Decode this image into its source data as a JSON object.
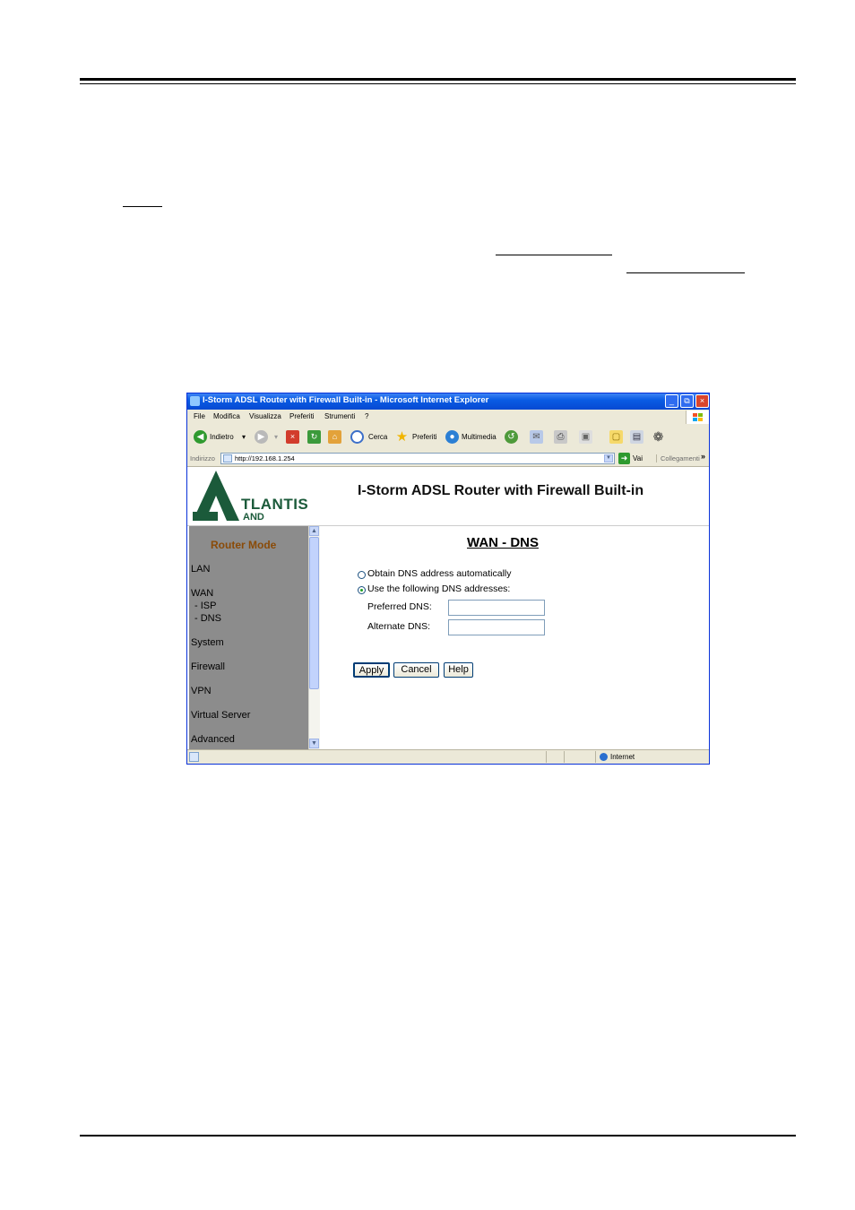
{
  "browser": {
    "title": "I-Storm ADSL Router with Firewall Built-in - Microsoft Internet Explorer",
    "window_controls": {
      "minimize": "_",
      "restore": "⧉",
      "close": "×"
    },
    "menu": [
      "File",
      "Modifica",
      "Visualizza",
      "Preferiti",
      "Strumenti",
      "?"
    ],
    "toolbar": {
      "back_label": "Indietro",
      "search_label": "Cerca",
      "favorites_label": "Preferiti",
      "media_label": "Multimedia"
    },
    "address": {
      "label": "Indirizzo",
      "url": "http://192.168.1.254",
      "go_label": "Vai",
      "links_label": "Collegamenti"
    },
    "status": {
      "zone": "Internet"
    }
  },
  "page": {
    "logo_text": "TLANTIS",
    "logo_sub": "AND",
    "heading": "I-Storm ADSL Router with Firewall Built-in",
    "sidebar": {
      "mode": "Router Mode",
      "items": [
        {
          "label": "LAN"
        },
        {
          "label": "WAN"
        },
        {
          "label": "- ISP"
        },
        {
          "label": "- DNS"
        },
        {
          "label": "System"
        },
        {
          "label": "Firewall"
        },
        {
          "label": "VPN"
        },
        {
          "label": "Virtual Server"
        },
        {
          "label": "Advanced"
        }
      ]
    },
    "section_title": "WAN - DNS",
    "options": {
      "auto": "Obtain DNS address automatically",
      "manual": "Use the following DNS addresses:",
      "selected": "manual"
    },
    "fields": {
      "preferred_label": "Preferred DNS:",
      "preferred_value": "",
      "alternate_label": "Alternate DNS:",
      "alternate_value": ""
    },
    "buttons": {
      "apply": "Apply",
      "cancel": "Cancel",
      "help": "Help"
    }
  },
  "colors": {
    "titlebar": "#0a5ce4",
    "sidebar_bg": "#8c8c8c",
    "router_mode_text": "#8a4b08",
    "logo_green": "#1b5a3a"
  }
}
